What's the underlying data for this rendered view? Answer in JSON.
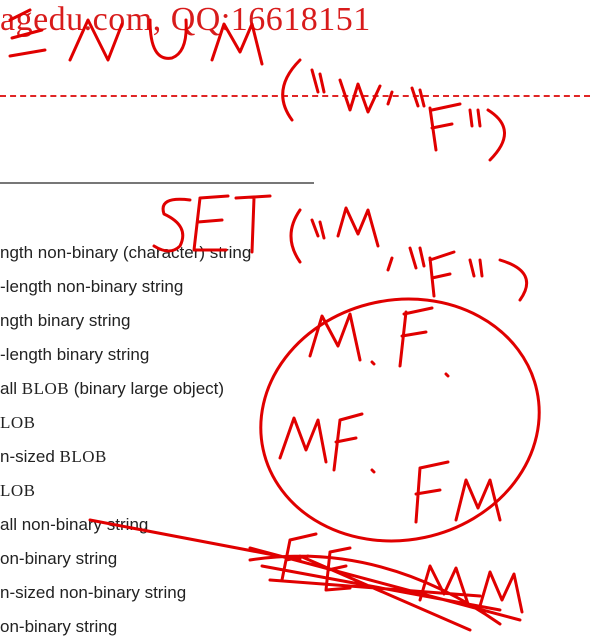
{
  "header": {
    "watermark": "agedu.com, QQ:16618151"
  },
  "content": {
    "items": [
      {
        "label": "ngth non-binary (character) string",
        "mono": ""
      },
      {
        "label": "-length non-binary string",
        "mono": ""
      },
      {
        "label": "ngth binary string",
        "mono": ""
      },
      {
        "label": "-length binary string",
        "mono": ""
      },
      {
        "label": "all ",
        "mono": "BLOB",
        "suffix": " (binary large object)"
      },
      {
        "label": "",
        "mono": "LOB",
        "suffix": ""
      },
      {
        "label": "n-sized ",
        "mono": "BLOB",
        "suffix": ""
      },
      {
        "label": "",
        "mono": "LOB",
        "suffix": ""
      },
      {
        "label": "all non-binary string",
        "mono": ""
      },
      {
        "label": "on-binary string",
        "mono": ""
      },
      {
        "label": "n-sized non-binary string",
        "mono": ""
      },
      {
        "label": "on-binary string",
        "mono": ""
      }
    ]
  },
  "annotations": {
    "color": "#e00000",
    "handwriting": [
      "ENUM('M','F')",
      "SET('M','F')",
      "M. F.",
      "MF. FM",
      "FE MM"
    ]
  }
}
